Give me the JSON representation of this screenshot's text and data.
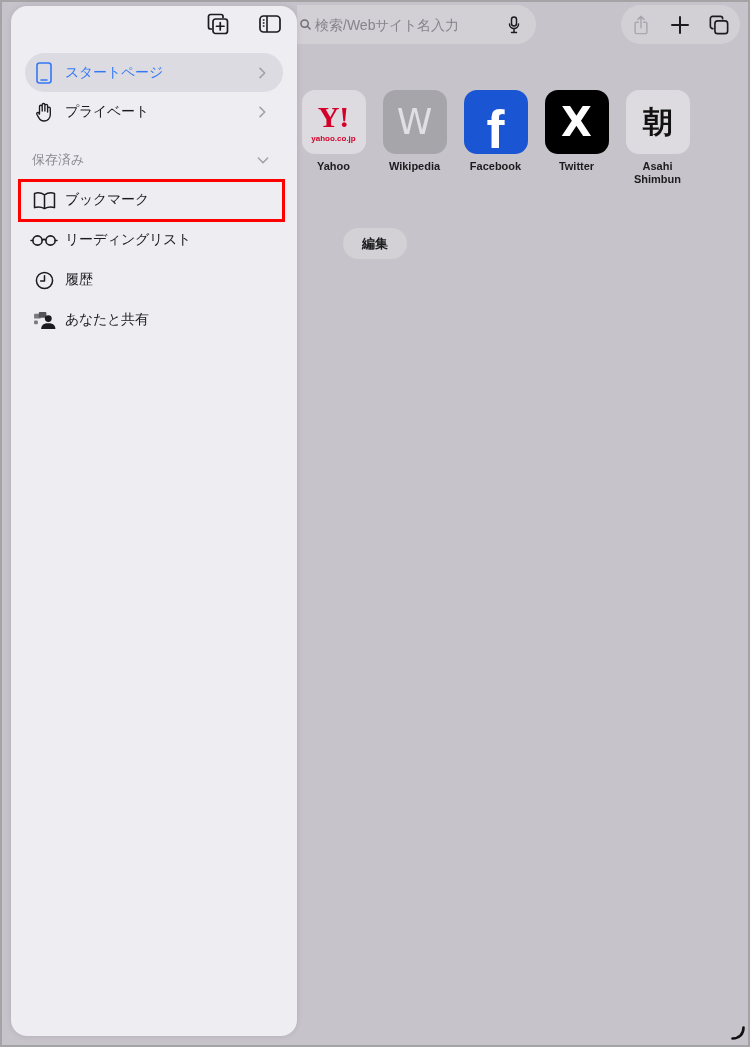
{
  "search_field": {
    "placeholder": "検索/Webサイト名入力"
  },
  "toolbar": [
    {
      "kind": "share",
      "disabled": true
    },
    {
      "kind": "new-tab",
      "disabled": false
    },
    {
      "kind": "tabs",
      "disabled": false
    }
  ],
  "favorites": [
    {
      "label": "Yahoo",
      "color": "#dddbe0",
      "logo": [
        {
          "text": "Y!",
          "kind": "serif",
          "color": "#d4002a"
        },
        {
          "text": "yahoo.co.jp",
          "kind": "caption",
          "color": "#d4002a"
        }
      ]
    },
    {
      "label": "Wikipedia",
      "color": "#a6a5aa",
      "logo": [
        {
          "text": "W",
          "kind": "thin",
          "color": "#e0dfe3"
        }
      ]
    },
    {
      "label": "Facebook",
      "color": "#1a56d4",
      "logo": [
        {
          "text": "f",
          "kind": "heavy",
          "color": "#ffffff"
        }
      ]
    },
    {
      "label": "Twitter",
      "color": "#000000",
      "logo": [
        {
          "text": "X",
          "kind": "bold",
          "color": "#ffffff"
        }
      ]
    },
    {
      "label": "Asahi Shimbun",
      "color": "#dddbe0",
      "logo": [
        {
          "text": "朝",
          "kind": "serif",
          "color": "#111111"
        }
      ]
    }
  ],
  "edit_button": {
    "label": "編集"
  },
  "sidebar": {
    "tab_groups": [
      {
        "label": "スタートページ",
        "selected": true
      },
      {
        "label": "プライベート",
        "selected": false
      }
    ],
    "saved": {
      "title": "保存済み",
      "expanded": true,
      "items": [
        {
          "label": "ブックマーク",
          "selected": false,
          "highlighted": true
        },
        {
          "label": "リーディングリスト",
          "selected": false,
          "highlighted": false
        },
        {
          "label": "履歴",
          "selected": false,
          "highlighted": false
        },
        {
          "label": "あなたと共有",
          "selected": false,
          "highlighted": false
        }
      ]
    }
  }
}
